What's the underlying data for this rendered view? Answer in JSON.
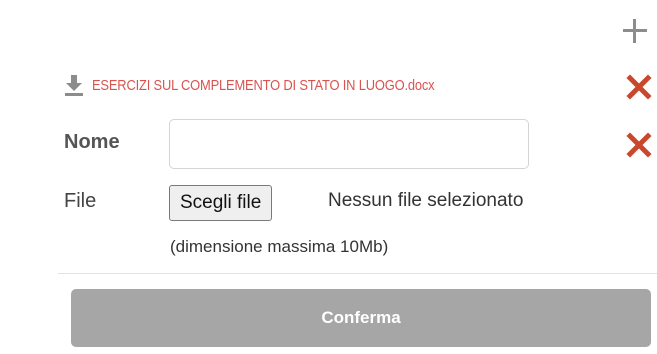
{
  "toolbar": {
    "add_icon": "plus-icon"
  },
  "attachment": {
    "filename": "ESERCIZI SUL COMPLEMENTO DI STATO IN LUOGO.docx",
    "download_icon": "download-icon",
    "remove_icon": "close-icon",
    "link_color": "#d9534f"
  },
  "form": {
    "name_label": "Nome",
    "name_value": "",
    "file_label": "File",
    "choose_file_label": "Scegli file",
    "no_file_text": "Nessun file selezionato",
    "size_note": "(dimensione massima 10Mb)",
    "remove_icon": "close-icon"
  },
  "submit": {
    "label": "Conferma",
    "bg_color": "#a6a6a6"
  }
}
